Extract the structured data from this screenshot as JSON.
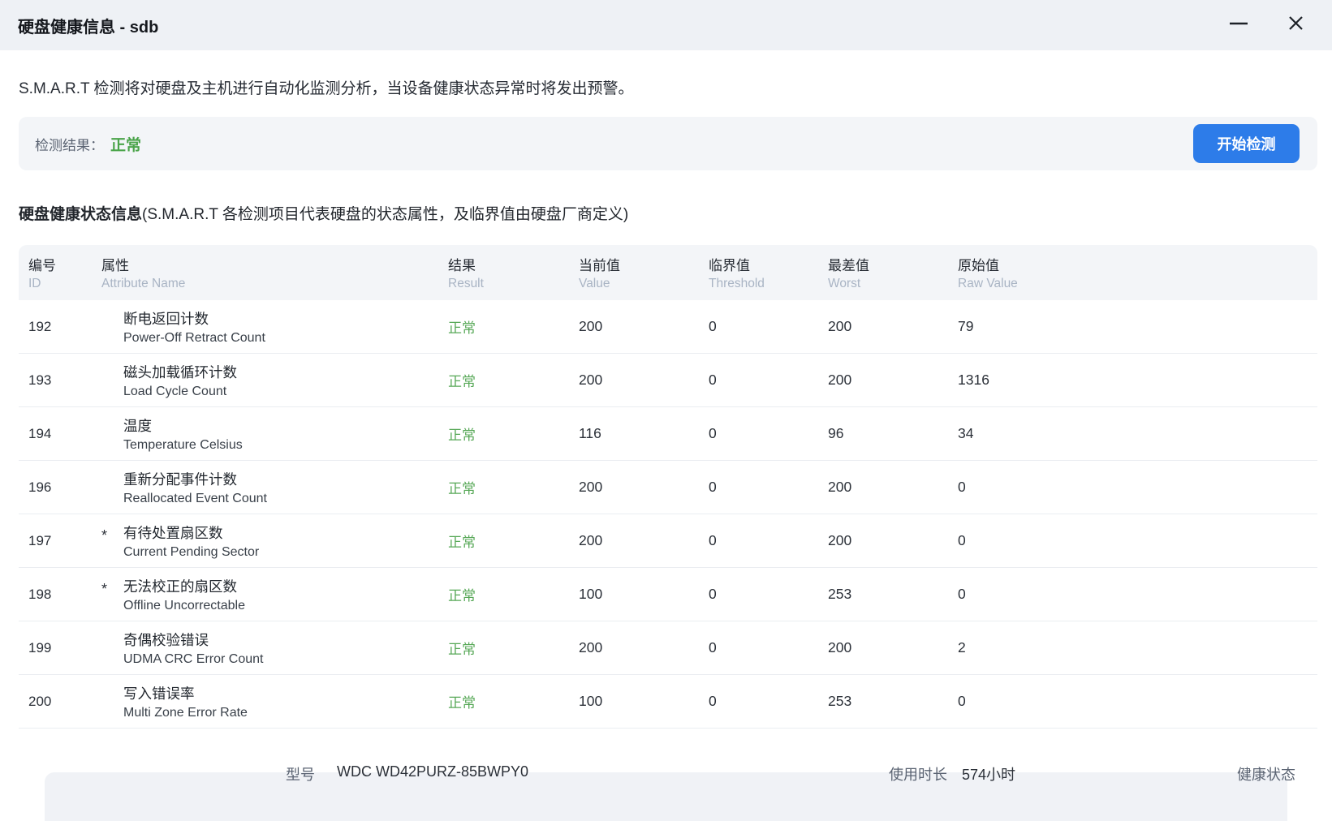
{
  "window": {
    "title": "硬盘健康信息 - sdb"
  },
  "intro": "S.M.A.R.T 检测将对硬盘及主机进行自动化监测分析，当设备健康状态异常时将发出预警。",
  "result": {
    "label": "检测结果：",
    "value": "正常",
    "value_color": "#4aa44a",
    "button": "开始检测",
    "button_color": "#2d7ce9"
  },
  "section": {
    "title": "硬盘健康状态信息",
    "note": "(S.M.A.R.T 各检测项目代表硬盘的状态属性，及临界值由硬盘厂商定义)"
  },
  "table": {
    "normal_color": "#57a857",
    "headers": {
      "id": {
        "zh": "编号",
        "en": "ID"
      },
      "attr": {
        "zh": "属性",
        "en": "Attribute Name"
      },
      "result": {
        "zh": "结果",
        "en": "Result"
      },
      "value": {
        "zh": "当前值",
        "en": "Value"
      },
      "threshold": {
        "zh": "临界值",
        "en": "Threshold"
      },
      "worst": {
        "zh": "最差值",
        "en": "Worst"
      },
      "raw": {
        "zh": "原始值",
        "en": "Raw Value"
      }
    },
    "rows": [
      {
        "id": "192",
        "flag": "",
        "zh": "断电返回计数",
        "en": "Power-Off Retract Count",
        "result": "正常",
        "value": "200",
        "threshold": "0",
        "worst": "200",
        "raw": "79"
      },
      {
        "id": "193",
        "flag": "",
        "zh": "磁头加载循环计数",
        "en": "Load Cycle Count",
        "result": "正常",
        "value": "200",
        "threshold": "0",
        "worst": "200",
        "raw": "1316"
      },
      {
        "id": "194",
        "flag": "",
        "zh": "温度",
        "en": "Temperature Celsius",
        "result": "正常",
        "value": "116",
        "threshold": "0",
        "worst": "96",
        "raw": "34"
      },
      {
        "id": "196",
        "flag": "",
        "zh": "重新分配事件计数",
        "en": "Reallocated Event Count",
        "result": "正常",
        "value": "200",
        "threshold": "0",
        "worst": "200",
        "raw": "0"
      },
      {
        "id": "197",
        "flag": "*",
        "zh": "有待处置扇区数",
        "en": "Current Pending Sector",
        "result": "正常",
        "value": "200",
        "threshold": "0",
        "worst": "200",
        "raw": "0"
      },
      {
        "id": "198",
        "flag": "*",
        "zh": "无法校正的扇区数",
        "en": "Offline Uncorrectable",
        "result": "正常",
        "value": "100",
        "threshold": "0",
        "worst": "253",
        "raw": "0"
      },
      {
        "id": "199",
        "flag": "",
        "zh": "奇偶校验错误",
        "en": "UDMA CRC Error Count",
        "result": "正常",
        "value": "200",
        "threshold": "0",
        "worst": "200",
        "raw": "2"
      },
      {
        "id": "200",
        "flag": "",
        "zh": "写入错误率",
        "en": "Multi Zone Error Rate",
        "result": "正常",
        "value": "100",
        "threshold": "0",
        "worst": "253",
        "raw": "0"
      }
    ]
  },
  "footer": {
    "model_label": "型号",
    "model_value": "WDC WD42PURZ-85BWPY0",
    "usage_label": "使用时长",
    "usage_value": "574小时",
    "health_label": "健康状态"
  }
}
